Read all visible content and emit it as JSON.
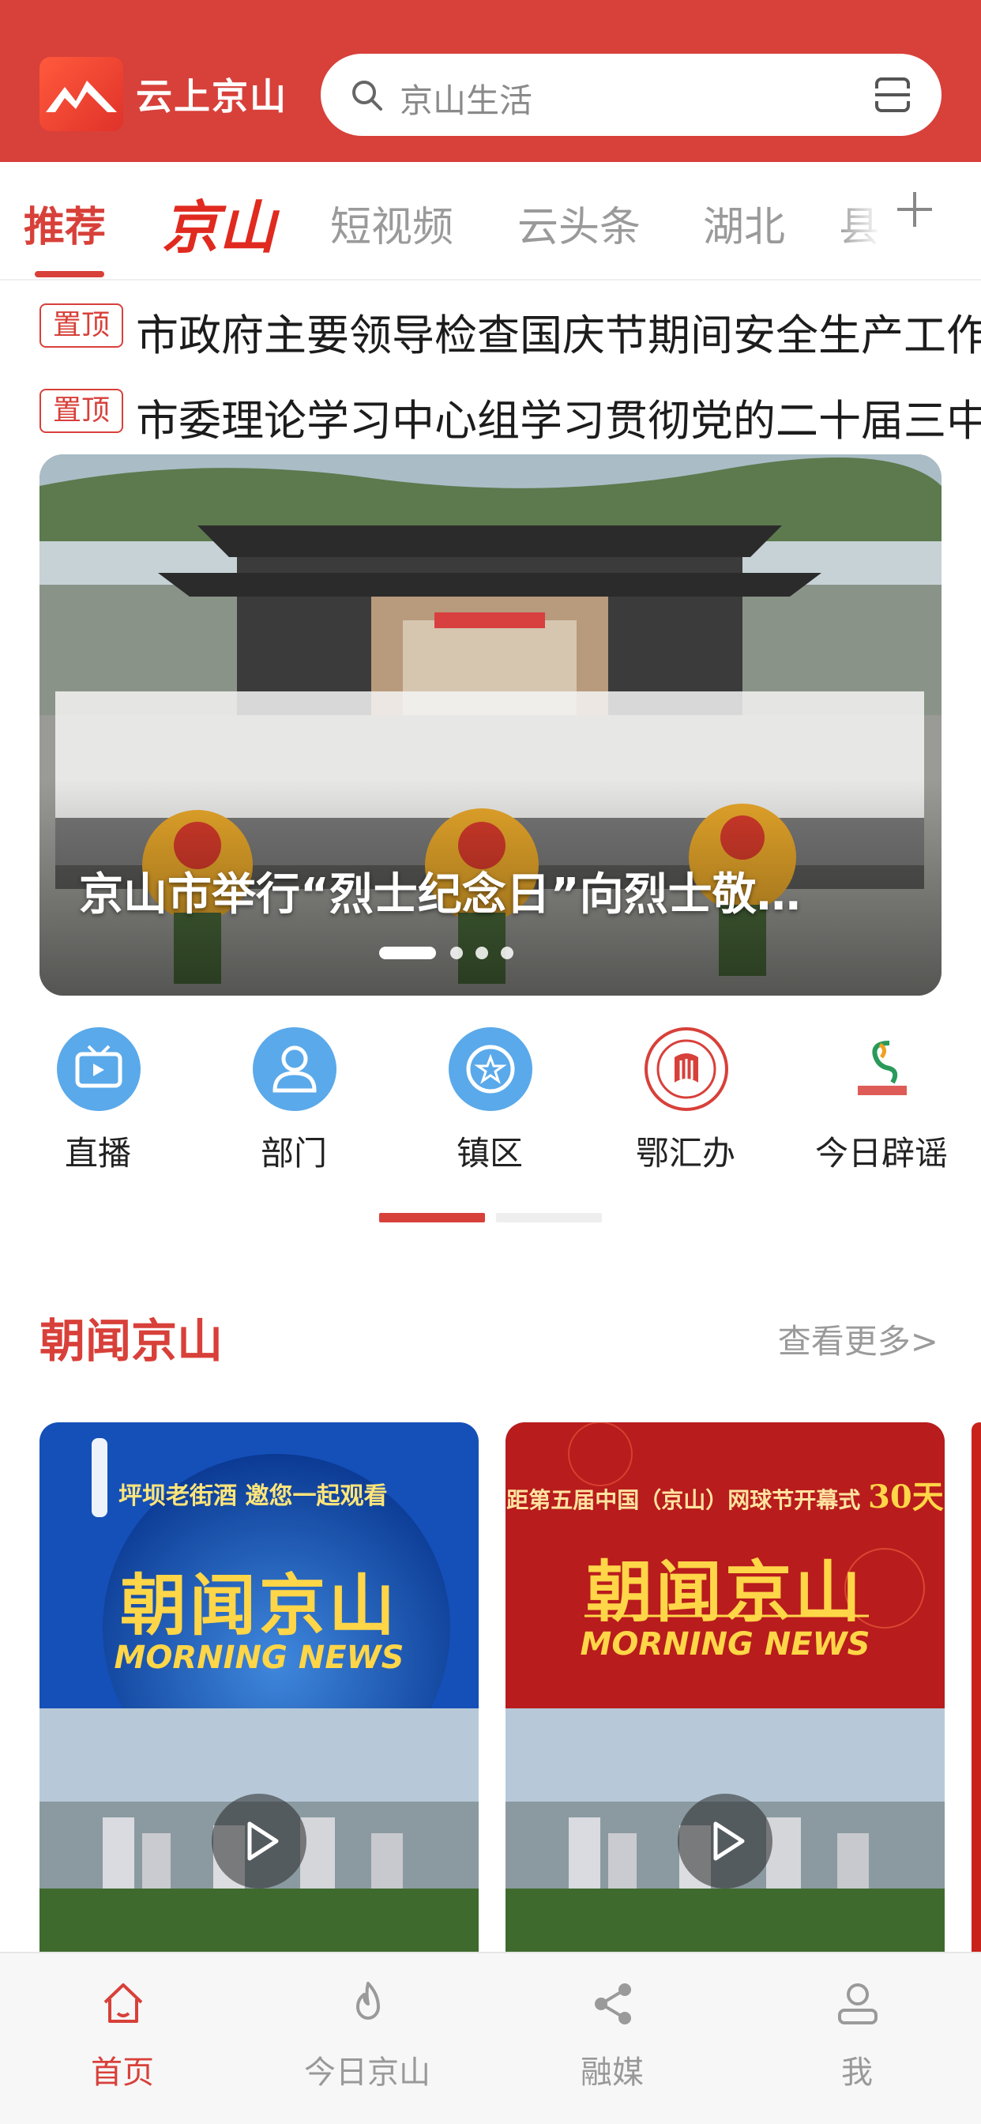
{
  "header": {
    "app_name": "云上京山",
    "search_placeholder": "京山生活"
  },
  "tabs": {
    "items": [
      "推荐",
      "京山",
      "短视频",
      "云头条",
      "湖北",
      "县"
    ],
    "active": "推荐"
  },
  "pinned": [
    {
      "badge": "置顶",
      "text": "市政府主要领导检查国庆节期间安全生产工作"
    },
    {
      "badge": "置顶",
      "text": "市委理论学习中心组学习贯彻党的二十届三中全会"
    }
  ],
  "banner": {
    "caption": "京山市举行“烈士纪念日”向烈士敬…",
    "slide_count": 4,
    "active_slide": 1
  },
  "quick_links": [
    {
      "label": "直播",
      "icon": "live-tv-icon",
      "color": "#5aa9ea"
    },
    {
      "label": "部门",
      "icon": "person-icon",
      "color": "#5aa9ea"
    },
    {
      "label": "镇区",
      "icon": "star-badge-icon",
      "color": "#5aa9ea"
    },
    {
      "label": "鄂汇办",
      "icon": "ehuiban-logo-icon",
      "color": "#d8403a"
    },
    {
      "label": "今日辟谣",
      "icon": "piyao-logo-icon",
      "color": "#2a9a5a"
    }
  ],
  "section": {
    "title": "朝闻京山",
    "more": "查看更多>"
  },
  "cards": [
    {
      "top_text": "坪坝老街酒 邀您一起观看",
      "title": "朝闻京山",
      "subtitle": "MORNING NEWS"
    },
    {
      "top_text": "距第五届中国（京山）网球节开幕式",
      "top_days": "30天",
      "title": "朝闻京山",
      "subtitle": "MORNING NEWS"
    }
  ],
  "bottom_nav": [
    {
      "label": "首页",
      "icon": "home-icon",
      "active": true
    },
    {
      "label": "今日京山",
      "icon": "flame-icon",
      "active": false
    },
    {
      "label": "融媒",
      "icon": "share-icon",
      "active": false
    },
    {
      "label": "我",
      "icon": "user-icon",
      "active": false
    }
  ],
  "colors": {
    "brand_red": "#d8403a",
    "inactive_gray": "#9a9a9a"
  }
}
